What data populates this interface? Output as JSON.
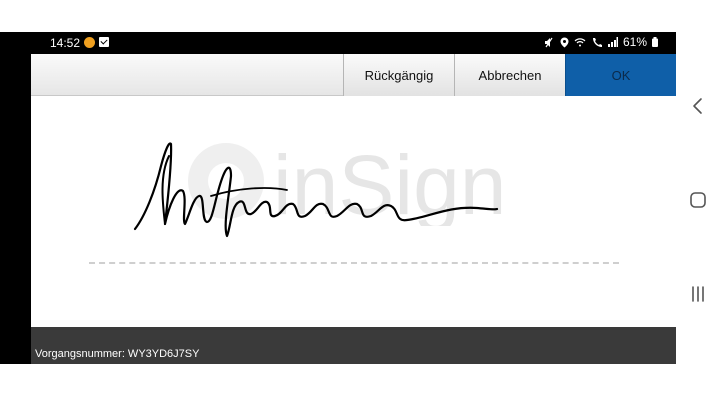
{
  "status_bar": {
    "time": "14:52",
    "battery": "61%",
    "icons": [
      "mute-icon",
      "location-icon",
      "wifi-icon",
      "wifi-call-icon",
      "signal-icon",
      "battery-icon"
    ]
  },
  "toolbar": {
    "undo_label": "Rückgängig",
    "cancel_label": "Abbrechen",
    "ok_label": "OK"
  },
  "signature_pad": {
    "watermark_text": "inSign"
  },
  "footer": {
    "case_number": "Vorgangsnummer: WY3YD6J7SY"
  },
  "colors": {
    "ok_button": "#0f5fa8",
    "footer": "#3a3a3a",
    "status_bar": "#000000"
  }
}
